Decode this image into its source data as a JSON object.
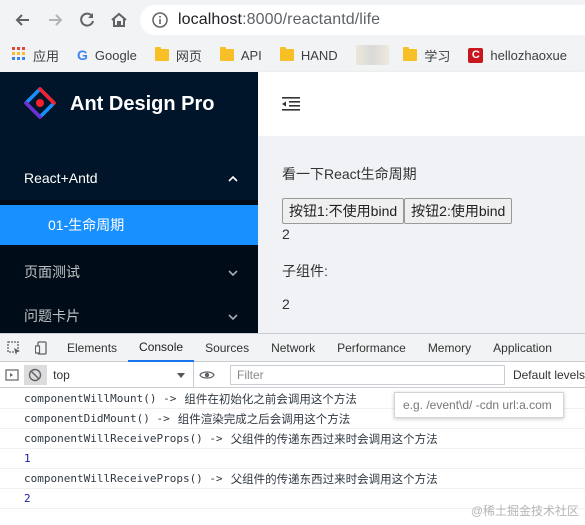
{
  "browser": {
    "url_host": "localhost",
    "url_rest": ":8000/reactantd/life",
    "bookmarks": [
      {
        "label": "应用",
        "icon": "apps-grid-icon"
      },
      {
        "label": "Google",
        "icon": "google-icon"
      },
      {
        "label": "网页",
        "icon": "folder-icon"
      },
      {
        "label": "API",
        "icon": "folder-icon"
      },
      {
        "label": "HAND",
        "icon": "folder-icon"
      },
      {
        "label": "学习",
        "icon": "folder-icon"
      },
      {
        "label": "hellozhaoxue",
        "icon": "csdn-icon"
      }
    ]
  },
  "sider": {
    "logo_text": "Ant Design Pro",
    "submenu_label": "React+Antd",
    "selected_item": "01-生命周期",
    "item3": "页面测试",
    "item4": "问题卡片"
  },
  "content": {
    "heading": "看一下React生命周期",
    "button1": "按钮1:不使用bind",
    "button2": "按钮2:使用bind",
    "count": "2",
    "child_label": "子组件:",
    "child_count": "2"
  },
  "devtools": {
    "tabs": [
      "Elements",
      "Console",
      "Sources",
      "Network",
      "Performance",
      "Memory",
      "Application"
    ],
    "active_tab": "Console",
    "context": "top",
    "filter_placeholder": "Filter",
    "levels": "Default levels",
    "tooltip": "e.g. /event\\d/ -cdn url:a.com",
    "lines": [
      {
        "code": "componentWillMount()  ->",
        "note": "组件在初始化之前会调用这个方法"
      },
      {
        "code": "componentDidMount()  ->",
        "note": "组件渲染完成之后会调用这个方法"
      },
      {
        "code": "componentWillReceiveProps()  ->",
        "note": "父组件的传递东西过来时会调用这个方法"
      },
      {
        "code": "1",
        "note": ""
      },
      {
        "code": "componentWillReceiveProps()  ->",
        "note": "父组件的传递东西过来时会调用这个方法"
      },
      {
        "code": "2",
        "note": ""
      }
    ]
  },
  "watermark": "@稀土掘金技术社区",
  "colors": {
    "sider": "#001529",
    "primary": "#1890ff",
    "chrome": "#f1f3f4"
  }
}
